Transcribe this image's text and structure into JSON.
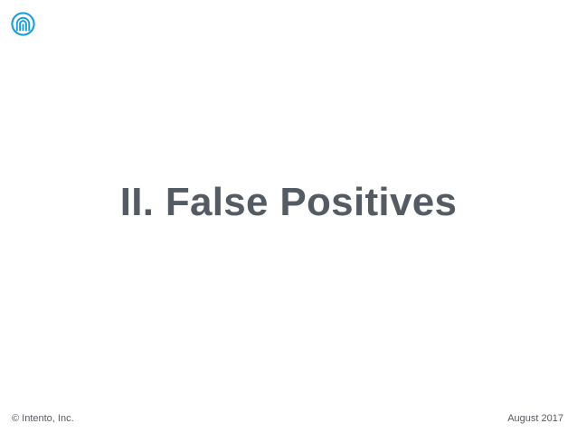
{
  "brand": {
    "logo_icon": "intento-logo-icon",
    "accent_color": "#1aa0d8"
  },
  "slide": {
    "title": "II. False Positives"
  },
  "footer": {
    "copyright": "© Intento, Inc.",
    "date": "August 2017"
  },
  "colors": {
    "text": "#555b63",
    "background": "#ffffff"
  }
}
